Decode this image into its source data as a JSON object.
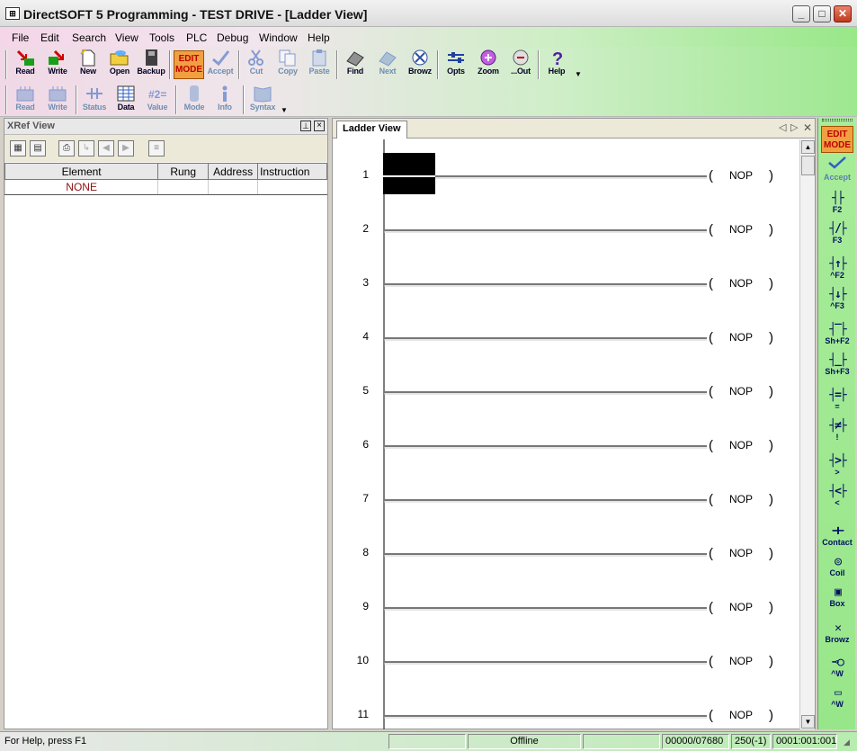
{
  "window": {
    "title": "DirectSOFT 5 Programming - TEST DRIVE - [Ladder View]",
    "app_icon": "ladder-app-icon"
  },
  "menu": [
    "File",
    "Edit",
    "Search",
    "View",
    "Tools",
    "PLC",
    "Debug",
    "Window",
    "Help"
  ],
  "toolbar1": {
    "read": "Read",
    "write": "Write",
    "new": "New",
    "open": "Open",
    "backup": "Backup",
    "edit_mode_line1": "EDIT",
    "edit_mode_line2": "MODE",
    "accept": "Accept",
    "cut": "Cut",
    "copy": "Copy",
    "paste": "Paste",
    "find": "Find",
    "next": "Next",
    "browz": "Browz",
    "opts": "Opts",
    "zoom": "Zoom",
    "out": "...Out",
    "help": "Help"
  },
  "toolbar2": {
    "read": "Read",
    "write": "Write",
    "status": "Status",
    "data": "Data",
    "value": "Value",
    "mode": "Mode",
    "info": "Info",
    "syntax": "Syntax"
  },
  "xref": {
    "title": "XRef View",
    "columns": [
      "Element",
      "Rung",
      "Address",
      "Instruction"
    ],
    "rows": [
      {
        "element": "NONE",
        "rung": "",
        "address": "",
        "instruction": ""
      }
    ]
  },
  "ladder": {
    "tab": "Ladder View",
    "rungs": [
      {
        "number": "1",
        "instruction": "NOP"
      },
      {
        "number": "2",
        "instruction": "NOP"
      },
      {
        "number": "3",
        "instruction": "NOP"
      },
      {
        "number": "4",
        "instruction": "NOP"
      },
      {
        "number": "5",
        "instruction": "NOP"
      },
      {
        "number": "6",
        "instruction": "NOP"
      },
      {
        "number": "7",
        "instruction": "NOP"
      },
      {
        "number": "8",
        "instruction": "NOP"
      },
      {
        "number": "9",
        "instruction": "NOP"
      },
      {
        "number": "10",
        "instruction": "NOP"
      },
      {
        "number": "11",
        "instruction": "NOP"
      }
    ]
  },
  "palette": {
    "edit_line1": "EDIT",
    "edit_line2": "MODE",
    "accept": "Accept",
    "items": [
      {
        "label": "F2"
      },
      {
        "label": "F3"
      },
      {
        "label": "^F2"
      },
      {
        "label": "^F3"
      },
      {
        "label": "Sh+F2"
      },
      {
        "label": "Sh+F3"
      },
      {
        "label": "="
      },
      {
        "label": "!"
      },
      {
        "label": ">"
      },
      {
        "label": "<"
      },
      {
        "label": "Contact"
      },
      {
        "label": "Coil"
      },
      {
        "label": "Box"
      },
      {
        "label": "Browz"
      },
      {
        "label": "^W"
      },
      {
        "label": "^W"
      }
    ]
  },
  "status": {
    "help": "For Help, press F1",
    "mode": "Offline",
    "memory": "00000/07680",
    "rung": "250(-1)",
    "position": "0001:001:001"
  },
  "colors": {
    "edit_mode_bg": "#f0a040",
    "edit_mode_text": "#c00000",
    "palette_bg": "#a8ec9a"
  }
}
